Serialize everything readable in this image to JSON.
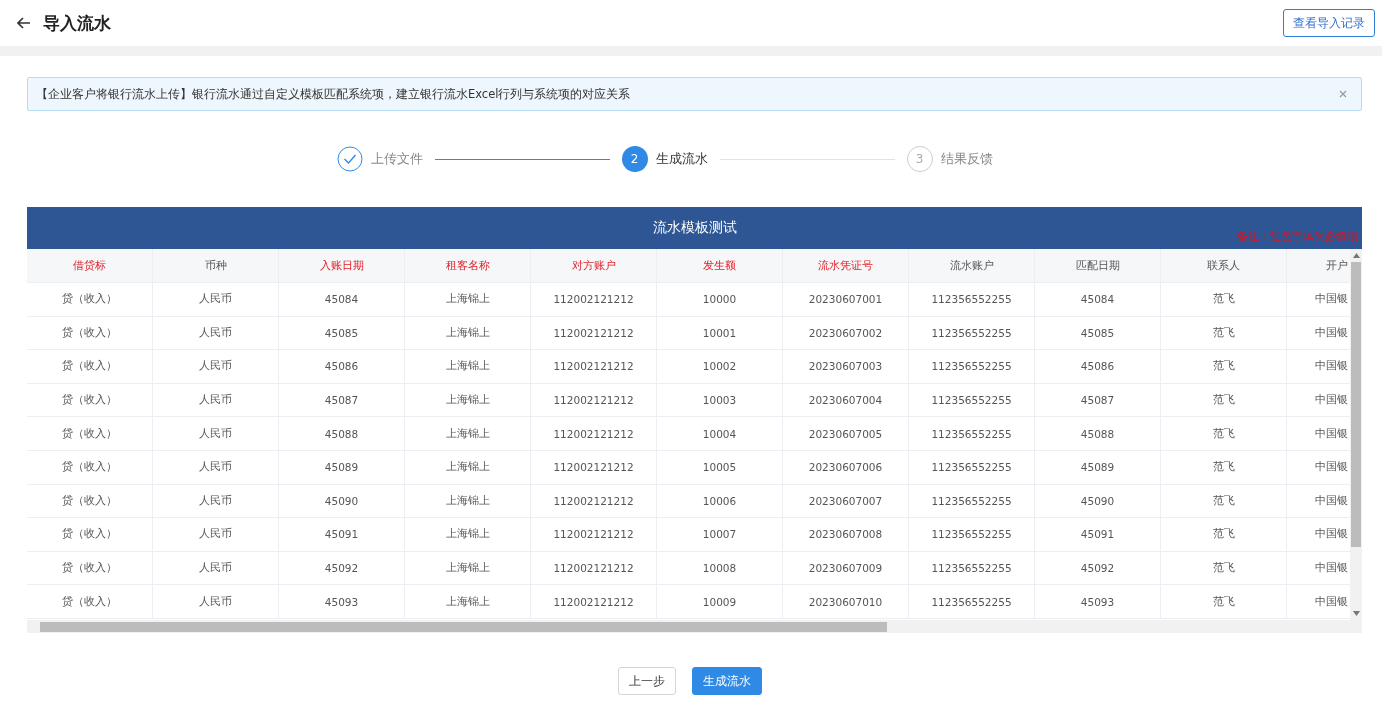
{
  "header": {
    "title": "导入流水",
    "action": "查看导入记录"
  },
  "alert": {
    "text": "【企业客户将银行流水上传】银行流水通过自定义模板匹配系统项，建立银行流水Excel行列与系统项的对应关系"
  },
  "steps": [
    {
      "label": "上传文件",
      "done": true,
      "active": false
    },
    {
      "number": "2",
      "label": "生成流水",
      "done": false,
      "active": true
    },
    {
      "number": "3",
      "label": "结果反馈",
      "done": false,
      "active": false
    }
  ],
  "table": {
    "title": "流水模板测试",
    "note": "备注：红色字体为必填项",
    "columns": [
      {
        "label": "借贷标",
        "required": true
      },
      {
        "label": "币种",
        "required": false
      },
      {
        "label": "入账日期",
        "required": true
      },
      {
        "label": "租客名称",
        "required": true
      },
      {
        "label": "对方账户",
        "required": true
      },
      {
        "label": "发生额",
        "required": true
      },
      {
        "label": "流水凭证号",
        "required": true
      },
      {
        "label": "流水账户",
        "required": false
      },
      {
        "label": "匹配日期",
        "required": false
      },
      {
        "label": "联系人",
        "required": false
      },
      {
        "label": "开户",
        "required": false
      }
    ],
    "rows": [
      [
        "贷（收入）",
        "人民币",
        "45084",
        "上海锦上",
        "112002121212",
        "10000",
        "20230607001",
        "112356552255",
        "45084",
        "范飞",
        "中国银"
      ],
      [
        "贷（收入）",
        "人民币",
        "45085",
        "上海锦上",
        "112002121212",
        "10001",
        "20230607002",
        "112356552255",
        "45085",
        "范飞",
        "中国银"
      ],
      [
        "贷（收入）",
        "人民币",
        "45086",
        "上海锦上",
        "112002121212",
        "10002",
        "20230607003",
        "112356552255",
        "45086",
        "范飞",
        "中国银"
      ],
      [
        "贷（收入）",
        "人民币",
        "45087",
        "上海锦上",
        "112002121212",
        "10003",
        "20230607004",
        "112356552255",
        "45087",
        "范飞",
        "中国银"
      ],
      [
        "贷（收入）",
        "人民币",
        "45088",
        "上海锦上",
        "112002121212",
        "10004",
        "20230607005",
        "112356552255",
        "45088",
        "范飞",
        "中国银"
      ],
      [
        "贷（收入）",
        "人民币",
        "45089",
        "上海锦上",
        "112002121212",
        "10005",
        "20230607006",
        "112356552255",
        "45089",
        "范飞",
        "中国银"
      ],
      [
        "贷（收入）",
        "人民币",
        "45090",
        "上海锦上",
        "112002121212",
        "10006",
        "20230607007",
        "112356552255",
        "45090",
        "范飞",
        "中国银"
      ],
      [
        "贷（收入）",
        "人民币",
        "45091",
        "上海锦上",
        "112002121212",
        "10007",
        "20230607008",
        "112356552255",
        "45091",
        "范飞",
        "中国银"
      ],
      [
        "贷（收入）",
        "人民币",
        "45092",
        "上海锦上",
        "112002121212",
        "10008",
        "20230607009",
        "112356552255",
        "45092",
        "范飞",
        "中国银"
      ],
      [
        "贷（收入）",
        "人民币",
        "45093",
        "上海锦上",
        "112002121212",
        "10009",
        "20230607010",
        "112356552255",
        "45093",
        "范飞",
        "中国银"
      ]
    ]
  },
  "buttons": [
    {
      "label": "上一步",
      "kind": "default"
    },
    {
      "label": "生成流水",
      "kind": "primary"
    }
  ]
}
